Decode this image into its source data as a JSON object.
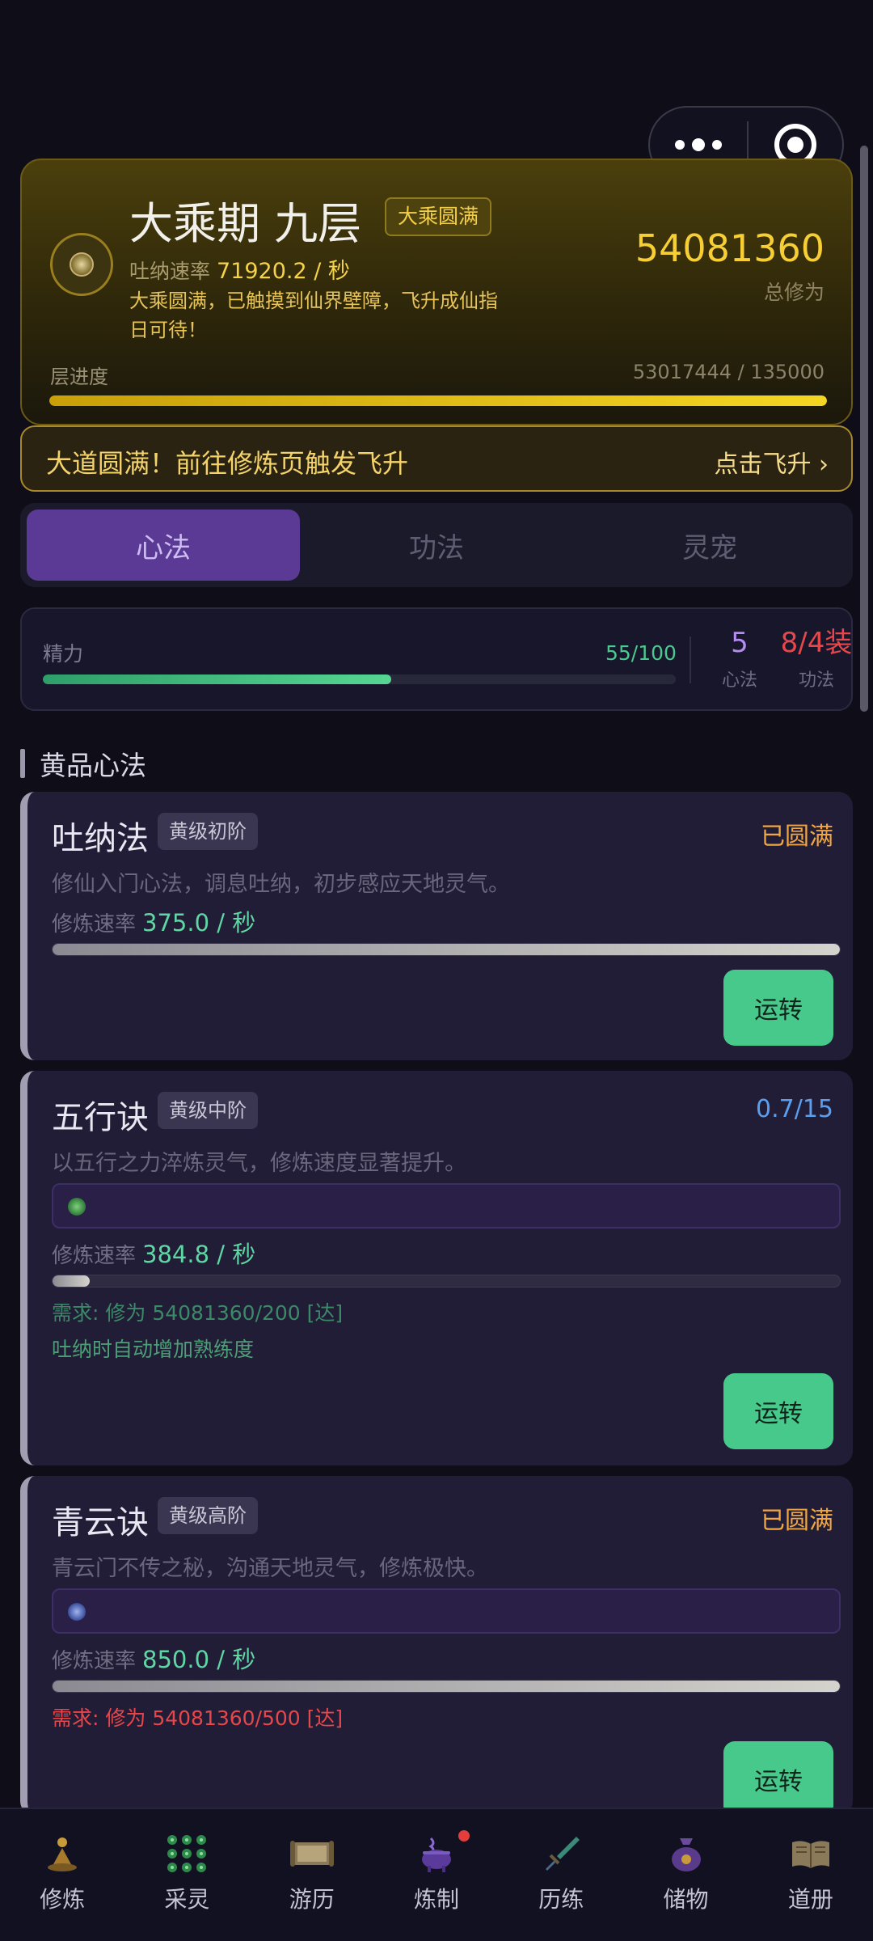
{
  "colors": {
    "gold": "#f6d24a",
    "accent_purple": "#5b3a96",
    "green": "#46c98a",
    "red": "#e7474a",
    "blue": "#5a9ef0",
    "orange": "#f0a642"
  },
  "realm": {
    "title": "大乘期 九层",
    "badge": "大乘圆满",
    "speed_label": "吐纳速率",
    "speed_value": "71920.2 / 秒",
    "description": "大乘圆满，已触摸到仙界壁障，飞升成仙指日可待！",
    "total_value": "54081360",
    "total_label": "总修为",
    "layer_label": "层进度",
    "layer_value": "53017444 / 135000",
    "layer_progress": 1.0
  },
  "ascend": {
    "message": "大道圆满！前往修炼页触发飞升",
    "action": "点击飞升 ›"
  },
  "tabs": [
    {
      "label": "心法",
      "active": true
    },
    {
      "label": "功法",
      "active": false
    },
    {
      "label": "灵宠",
      "active": false
    }
  ],
  "energy": {
    "label": "精力",
    "value": "55/100",
    "progress": 0.55,
    "stats": [
      {
        "value": "5",
        "label": "心法"
      },
      {
        "value": "8/4装",
        "label": "功法"
      }
    ]
  },
  "section": {
    "title": "黄品心法"
  },
  "skills": [
    {
      "name": "吐纳法",
      "grade": "黄级初阶",
      "status": "已圆满",
      "description": "修仙入门心法，调息吐纳，初步感应天地灵气。",
      "rate_label": "修炼速率",
      "rate_value": "375.0 / 秒",
      "progress": 1.0,
      "action": "运转"
    },
    {
      "name": "五行诀",
      "grade": "黄级中阶",
      "status": "0.7/15",
      "description": "以五行之力淬炼灵气，修炼速度显著提升。",
      "rate_label": "修炼速率",
      "rate_value": "384.8 / 秒",
      "progress": 0.047,
      "requirement": "需求: 修为 54081360/200 [达]",
      "note": "吐纳时自动增加熟练度",
      "action": "运转"
    },
    {
      "name": "青云诀",
      "grade": "黄级高阶",
      "status": "已圆满",
      "description": "青云门不传之秘，沟通天地灵气，修炼极快。",
      "rate_label": "修炼速率",
      "rate_value": "850.0 / 秒",
      "progress": 1.0,
      "requirement": "需求: 修为 54081360/500 [达]",
      "action": "运转"
    }
  ],
  "nav": [
    {
      "label": "修炼",
      "icon": "meditation-icon"
    },
    {
      "label": "采灵",
      "icon": "herb-grid-icon"
    },
    {
      "label": "游历",
      "icon": "scroll-map-icon"
    },
    {
      "label": "炼制",
      "icon": "cauldron-icon",
      "dot": true
    },
    {
      "label": "历练",
      "icon": "sword-icon"
    },
    {
      "label": "储物",
      "icon": "pouch-icon"
    },
    {
      "label": "道册",
      "icon": "book-icon"
    }
  ]
}
